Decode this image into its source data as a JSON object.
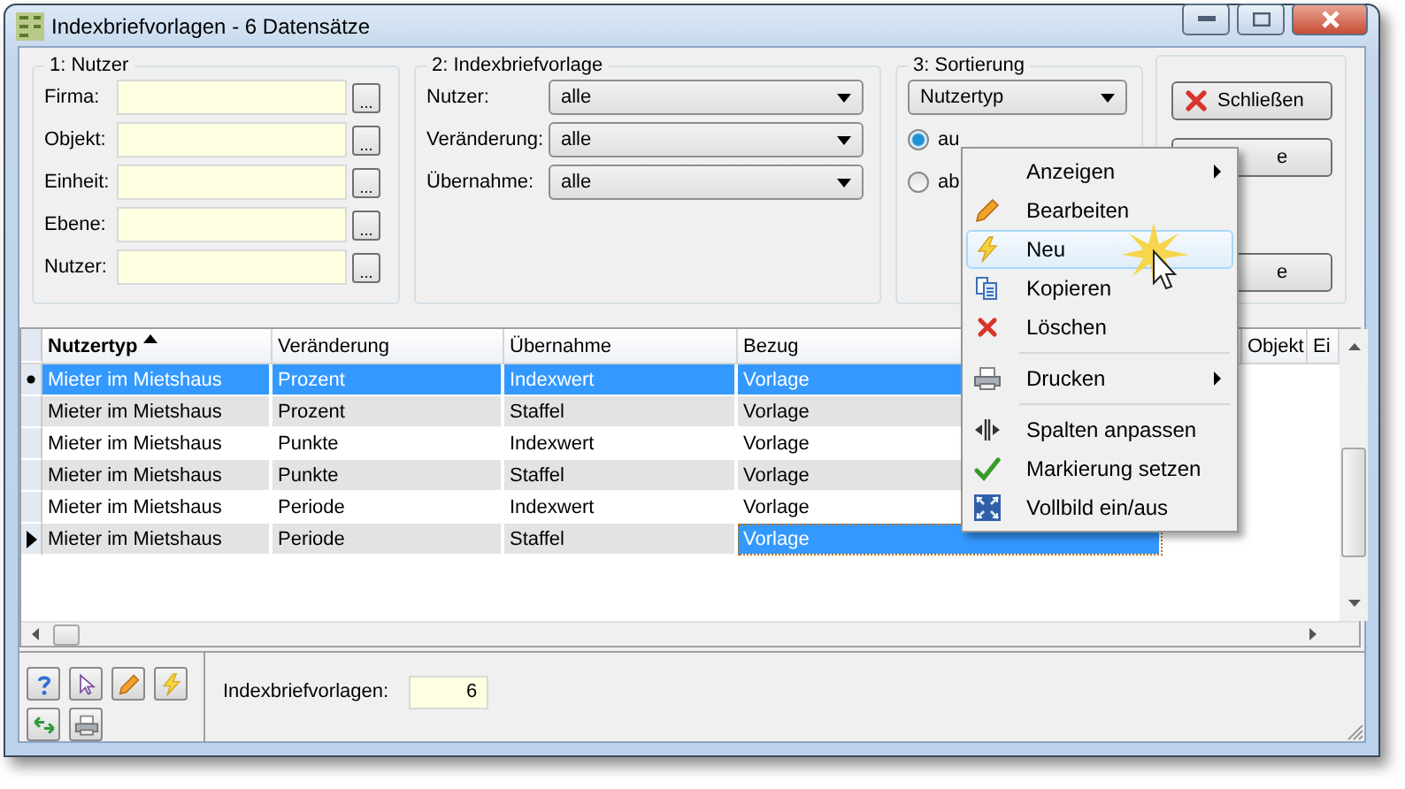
{
  "window": {
    "title": "Indexbriefvorlagen - 6 Datensätze"
  },
  "user_filter": {
    "title": "1: Nutzer",
    "fields": [
      {
        "label": "Firma:",
        "button": "..."
      },
      {
        "label": "Objekt:",
        "button": "..."
      },
      {
        "label": "Einheit:",
        "button": "..."
      },
      {
        "label": "Ebene:",
        "button": "..."
      },
      {
        "label": "Nutzer:",
        "button": "..."
      }
    ]
  },
  "template_filter": {
    "title": "2: Indexbriefvorlage",
    "selects": [
      {
        "label": "Nutzer:",
        "value": "alle"
      },
      {
        "label": "Veränderung:",
        "value": "alle"
      },
      {
        "label": "Übernahme:",
        "value": "alle"
      }
    ]
  },
  "sorting": {
    "title": "3: Sortierung",
    "select": "Nutzertyp",
    "radios": [
      {
        "label": "au",
        "selected": true
      },
      {
        "label": "ab",
        "selected": false
      }
    ]
  },
  "actions": [
    {
      "kind": "close",
      "label": "Schließen"
    },
    {
      "kind": "plain",
      "label": "e"
    },
    {
      "kind": "plain",
      "label": "e"
    }
  ],
  "table": {
    "columns": [
      {
        "label": "Nutzertyp",
        "sorted": true
      },
      {
        "label": "Veränderung",
        "sorted": false
      },
      {
        "label": "Übernahme",
        "sorted": false
      },
      {
        "label": "Bezug",
        "sorted": false
      },
      {
        "label": "Objekt",
        "sorted": false
      },
      {
        "label": "Ei",
        "sorted": false
      }
    ],
    "rows": [
      {
        "cells": [
          "Mieter im Mietshaus",
          "Prozent",
          "Indexwert",
          "Vorlage"
        ],
        "selected": true,
        "marked": true,
        "current": false
      },
      {
        "cells": [
          "Mieter im Mietshaus",
          "Prozent",
          "Staffel",
          "Vorlage"
        ],
        "selected": false,
        "marked": false,
        "current": false
      },
      {
        "cells": [
          "Mieter im Mietshaus",
          "Punkte",
          "Indexwert",
          "Vorlage"
        ],
        "selected": false,
        "marked": false,
        "current": false
      },
      {
        "cells": [
          "Mieter im Mietshaus",
          "Punkte",
          "Staffel",
          "Vorlage"
        ],
        "selected": false,
        "marked": false,
        "current": false
      },
      {
        "cells": [
          "Mieter im Mietshaus",
          "Periode",
          "Indexwert",
          "Vorlage"
        ],
        "selected": false,
        "marked": false,
        "current": false
      },
      {
        "cells": [
          "Mieter im Mietshaus",
          "Periode",
          "Staffel",
          "Vorlage"
        ],
        "selected": false,
        "marked": false,
        "current": true
      }
    ]
  },
  "context_menu": [
    {
      "kind": "item",
      "label": "Anzeigen",
      "submenu": true,
      "highlighted": false
    },
    {
      "kind": "item",
      "label": "Bearbeiten",
      "submenu": false,
      "highlighted": false
    },
    {
      "kind": "item",
      "label": "Neu",
      "submenu": false,
      "highlighted": true
    },
    {
      "kind": "item",
      "label": "Kopieren",
      "submenu": false,
      "highlighted": false
    },
    {
      "kind": "item",
      "label": "Löschen",
      "submenu": false,
      "highlighted": false
    },
    {
      "kind": "separator"
    },
    {
      "kind": "item",
      "label": "Drucken",
      "submenu": true,
      "highlighted": false
    },
    {
      "kind": "separator"
    },
    {
      "kind": "item",
      "label": "Spalten anpassen",
      "submenu": false,
      "highlighted": false
    },
    {
      "kind": "item",
      "label": "Markierung setzen",
      "submenu": false,
      "highlighted": false
    },
    {
      "kind": "item",
      "label": "Vollbild ein/aus",
      "submenu": false,
      "highlighted": false
    }
  ],
  "counter": {
    "label": "Indexbriefvorlagen:",
    "value": "6"
  }
}
